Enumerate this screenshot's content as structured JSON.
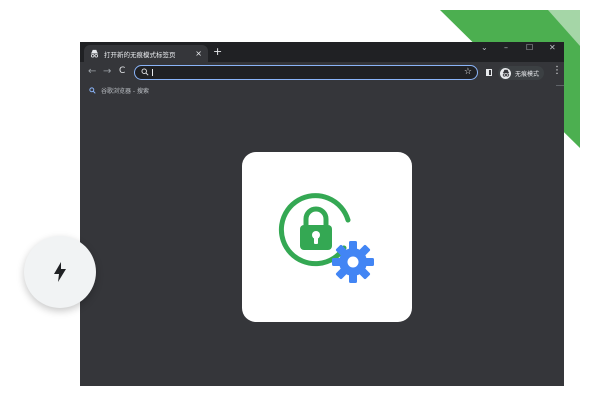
{
  "tab": {
    "title": "打开新的无痕模式标签页",
    "close_glyph": "×",
    "favicon": "incognito-icon"
  },
  "new_tab_glyph": "+",
  "window_controls": {
    "menu_glyph": "⌄",
    "minimize_glyph": "–",
    "maximize_glyph": "☐",
    "close_glyph": "✕"
  },
  "toolbar": {
    "back_glyph": "←",
    "forward_glyph": "→",
    "reload_glyph": "C",
    "bookmark_glyph": "☆",
    "menu_glyph": "⋮",
    "incognito_label": "无痕模式"
  },
  "omnibox": {
    "value": "",
    "icon": "search-icon"
  },
  "bookmarks": {
    "items": [
      {
        "label": "谷歌浏览器 - 搜索",
        "icon": "search-icon"
      }
    ]
  },
  "card": {
    "icon": "lock-with-gear-icon"
  },
  "floating_button": {
    "icon": "lightning-bolt-icon"
  },
  "colors": {
    "accent_green": "#34a853",
    "accent_blue": "#4285f4",
    "browser_dark": "#35363a",
    "tabstrip_dark": "#202124",
    "focus_ring": "#8ab4f8"
  }
}
